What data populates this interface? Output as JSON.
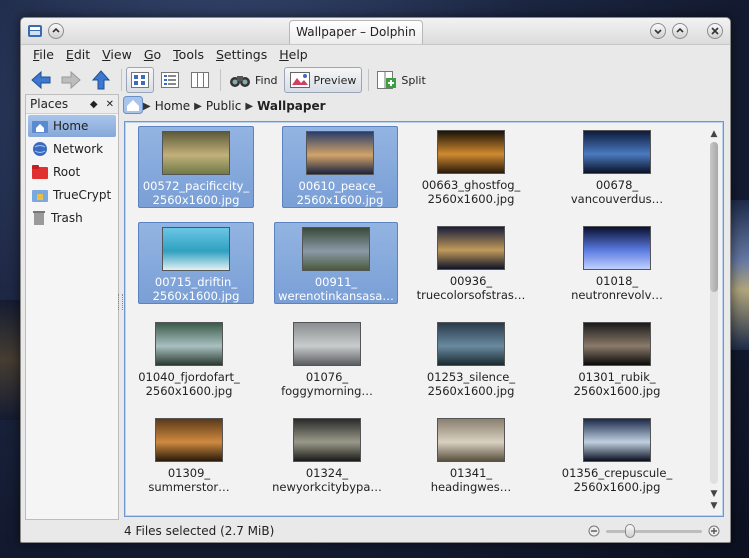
{
  "window": {
    "title": "Wallpaper – Dolphin"
  },
  "menu": [
    {
      "label": "File",
      "key": "F",
      "rest": "ile"
    },
    {
      "label": "Edit",
      "key": "E",
      "rest": "dit"
    },
    {
      "label": "View",
      "key": "V",
      "rest": "iew"
    },
    {
      "label": "Go",
      "key": "G",
      "rest": "o"
    },
    {
      "label": "Tools",
      "key": "T",
      "rest": "ools"
    },
    {
      "label": "Settings",
      "key": "S",
      "rest": "ettings"
    },
    {
      "label": "Help",
      "key": "H",
      "rest": "elp"
    }
  ],
  "toolbar": {
    "find_label": "Find",
    "preview_label": "Preview",
    "split_label": "Split"
  },
  "places": {
    "title": "Places",
    "items": [
      {
        "label": "Home",
        "icon": "home-folder-icon",
        "active": true
      },
      {
        "label": "Network",
        "icon": "network-globe-icon",
        "active": false
      },
      {
        "label": "Root",
        "icon": "root-folder-icon",
        "active": false
      },
      {
        "label": "TrueCrypt",
        "icon": "truecrypt-icon",
        "active": false
      },
      {
        "label": "Trash",
        "icon": "trash-icon",
        "active": false
      }
    ]
  },
  "breadcrumb": {
    "home": "Home",
    "parent": "Public",
    "current": "Wallpaper"
  },
  "files": [
    {
      "l1": "00572_pacificcity_",
      "l2": "2560x1600.jpg",
      "selected": true,
      "c": [
        "#5d5a3a",
        "#c2b07a",
        "#6f7a4a"
      ]
    },
    {
      "l1": "00610_peace_",
      "l2": "2560x1600.jpg",
      "selected": true,
      "c": [
        "#2a3e6a",
        "#d2a36a",
        "#1a2440"
      ]
    },
    {
      "l1": "00663_ghostfog_",
      "l2": "2560x1600.jpg",
      "selected": false,
      "c": [
        "#1a1208",
        "#d08a30",
        "#2a1a0a"
      ]
    },
    {
      "l1": "00678_",
      "l2": "vancouverdus…",
      "selected": false,
      "c": [
        "#0e1a3a",
        "#4a7ac0",
        "#0a1228"
      ]
    },
    {
      "l1": "00715_driftin_",
      "l2": "2560x1600.jpg",
      "selected": true,
      "c": [
        "#6ac6e6",
        "#30a0c0",
        "#e0f0f4"
      ]
    },
    {
      "l1": "00911_",
      "l2": "werenotinkansasa…",
      "selected": true,
      "c": [
        "#3a4a3a",
        "#8a9aa6",
        "#4a5a40"
      ]
    },
    {
      "l1": "00936_",
      "l2": "truecolorsofstras…",
      "selected": false,
      "c": [
        "#1a1e3a",
        "#c09a5a",
        "#101428"
      ]
    },
    {
      "l1": "01018_",
      "l2": "neutronrevolv…",
      "selected": false,
      "c": [
        "#0a1030",
        "#5a7ae0",
        "#c0d0ff"
      ]
    },
    {
      "l1": "01040_fjordofart_",
      "l2": "2560x1600.jpg",
      "selected": false,
      "c": [
        "#3a5a4a",
        "#a8c0c0",
        "#2a3a30"
      ]
    },
    {
      "l1": "01076_",
      "l2": "foggymorning…",
      "selected": false,
      "c": [
        "#8a8e90",
        "#c8cccc",
        "#5a5e60"
      ]
    },
    {
      "l1": "01253_silence_",
      "l2": "2560x1600.jpg",
      "selected": false,
      "c": [
        "#2a3a4a",
        "#6a8aa0",
        "#1a2a30"
      ]
    },
    {
      "l1": "01301_rubik_",
      "l2": "2560x1600.jpg",
      "selected": false,
      "c": [
        "#1a1a1a",
        "#8a7a6a",
        "#0a0a0a"
      ]
    },
    {
      "l1": "01309_",
      "l2": "summerstor…",
      "selected": false,
      "c": [
        "#5a3a1a",
        "#d08a40",
        "#2a1a0a"
      ]
    },
    {
      "l1": "01324_",
      "l2": "newyorkcitybypa…",
      "selected": false,
      "c": [
        "#2a2a2a",
        "#9a9a8a",
        "#1a1a1a"
      ]
    },
    {
      "l1": "01341_",
      "l2": "headingwes…",
      "selected": false,
      "c": [
        "#8a8070",
        "#d8d0c0",
        "#5a5040"
      ]
    },
    {
      "l1": "01356_crepuscule_",
      "l2": "2560x1600.jpg",
      "selected": false,
      "c": [
        "#1a2a4a",
        "#c0d0e0",
        "#0a1020"
      ]
    }
  ],
  "status": {
    "text": "4 Files selected (2.7 MiB)",
    "zoom_level": 0.25
  }
}
